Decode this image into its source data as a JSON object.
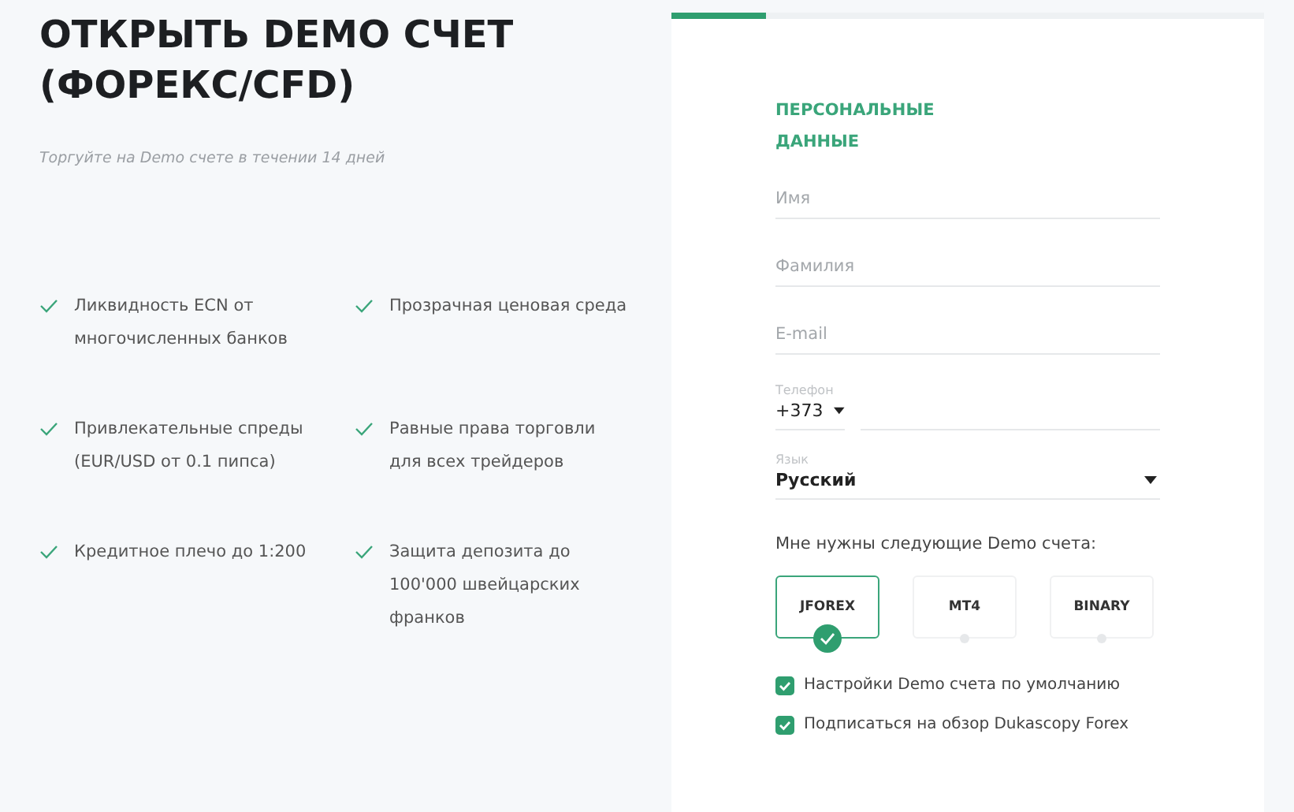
{
  "title": "ОТКРЫТЬ DEMO СЧЕТ (ФОРЕКС/CFD)",
  "subtitle": "Торгуйте на Demo счете в течении 14 дней",
  "features": [
    {
      "text": "Ликвидность ECN от многочисленных банков"
    },
    {
      "text": "Прозрачная ценовая среда"
    },
    {
      "text": "Привлекательные спреды (EUR/USD от 0.1 пипса)"
    },
    {
      "text": "Равные права торговли для всех трейдеров"
    },
    {
      "text": "Кредитное плечо до 1:200"
    },
    {
      "text": "Защита депозита до 100'000 швейцарских франков"
    }
  ],
  "form": {
    "progress": {
      "level": 0.16
    },
    "section_title": "ПЕРСОНАЛЬНЫЕ ДАННЫЕ",
    "fields": [
      {
        "kind": "text",
        "placeholder": "Имя"
      },
      {
        "kind": "text",
        "placeholder": "Фамилия"
      },
      {
        "kind": "text",
        "placeholder": "E-mail"
      },
      {
        "kind": "phone",
        "label": "Телефон",
        "code": "+373"
      },
      {
        "kind": "select",
        "label": "Язык",
        "value": "Русский"
      }
    ],
    "accounts_label": "Мне нужны следующие Demo счета:",
    "accounts": [
      {
        "label": "JFOREX",
        "selected": true
      },
      {
        "label": "MT4",
        "selected": false
      },
      {
        "label": "BINARY",
        "selected": false
      }
    ],
    "checkboxes": [
      {
        "label": "Настройки Demo счета по умолчанию",
        "checked": true
      },
      {
        "label": "Подписаться на обзор Dukascopy Forex",
        "checked": true
      }
    ]
  }
}
